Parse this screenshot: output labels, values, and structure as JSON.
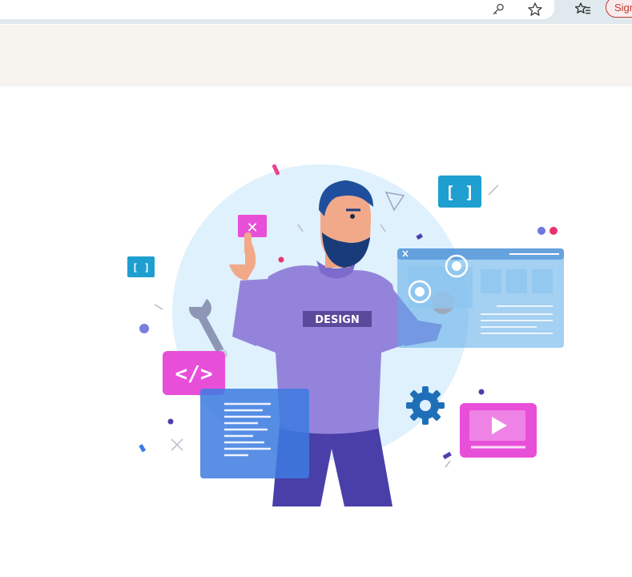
{
  "toolbar": {
    "sign_in_label": "Sign in",
    "icons": [
      "key-icon",
      "star-icon",
      "favorites-icon"
    ]
  },
  "illustration": {
    "shirt_text": "DESIGN",
    "code_tag": "</>",
    "bracket_large": "[ ]",
    "bracket_small": "[ ]",
    "close_mark": "✕"
  },
  "colors": {
    "accent_pink": "#e84fd9",
    "accent_purple": "#8a7ad6",
    "accent_teal": "#1e9fd0",
    "accent_blue": "#3d7be0",
    "sign_in_red": "#c0392b"
  }
}
